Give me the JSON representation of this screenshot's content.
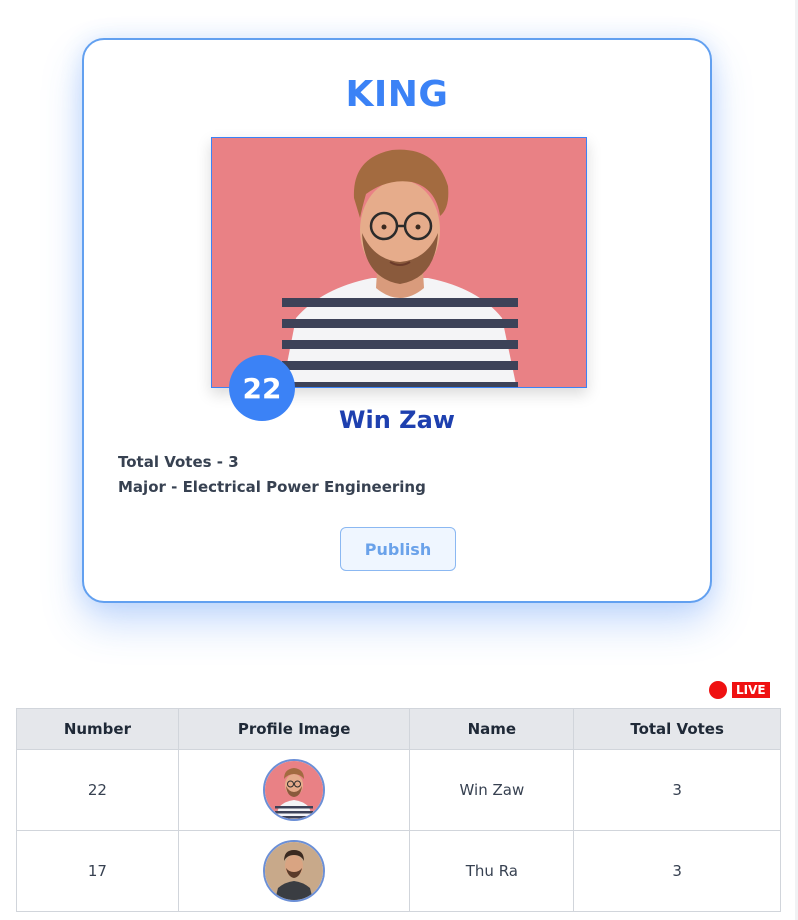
{
  "card": {
    "title": "KING",
    "candidate_number": "22",
    "candidate_name": "Win Zaw",
    "total_votes_text": "Total Votes - 3",
    "major_text": "Major - Electrical Power Engineering",
    "publish_label": "Publish"
  },
  "live_label": "LIVE",
  "table": {
    "headers": {
      "number": "Number",
      "profile_image": "Profile Image",
      "name": "Name",
      "total_votes": "Total Votes"
    },
    "rows": [
      {
        "number": "22",
        "name": "Win Zaw",
        "total_votes": "3"
      },
      {
        "number": "17",
        "name": "Thu Ra",
        "total_votes": "3"
      }
    ]
  },
  "colors": {
    "accent": "#3b82f6",
    "name_color": "#1e40af",
    "live_red": "#ef1111",
    "photo_background": "#e98185"
  },
  "icons": {
    "live_indicator": "red-dot-icon"
  }
}
